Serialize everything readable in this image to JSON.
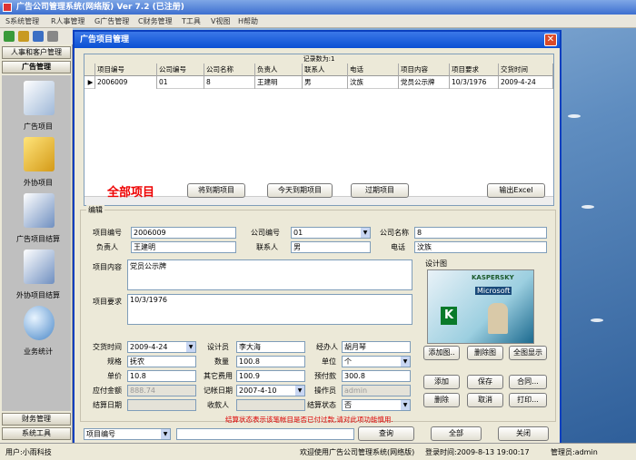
{
  "app": {
    "title": "广告公司管理系统(网络版) Ver 7.2 (已注册)"
  },
  "menu": [
    "S系统管理",
    "R人事管理",
    "G广告管理",
    "C财务管理",
    "T工具",
    "V视图",
    "H帮助"
  ],
  "sidebar": {
    "top_header": "人事和客户管理",
    "active_header": "广告管理",
    "items": [
      {
        "label": "广告项目"
      },
      {
        "label": "外协项目"
      },
      {
        "label": "广告项目结算"
      },
      {
        "label": "外协项目结算"
      },
      {
        "label": "业务统计"
      }
    ],
    "bottom_headers": [
      "财务管理",
      "系统工具"
    ]
  },
  "dialog": {
    "title": "广告项目管理",
    "record_count": "记录数为:1",
    "columns": [
      "项目编号",
      "公司编号",
      "公司名称",
      "负责人",
      "联系人",
      "电话",
      "项目内容",
      "项目要求",
      "交货时间"
    ],
    "rows": [
      [
        "2006009",
        "01",
        "8",
        "王建明",
        "男",
        "汶族",
        "党员公示牌",
        "10/3/1976",
        "2009-4-24"
      ]
    ],
    "filter_title": "全部项目",
    "buttons": {
      "due": "将到期项目",
      "today": "今天到期项目",
      "overdue": "过期项目",
      "excel": "输出Excel"
    },
    "edit_group": "编辑",
    "form": {
      "proj_no_label": "项目编号",
      "proj_no": "2006009",
      "company_no_label": "公司编号",
      "company_no": "01",
      "company_name_label": "公司名称",
      "company_name": "8",
      "owner_label": "负责人",
      "owner": "王建明",
      "contact_label": "联系人",
      "contact": "男",
      "phone_label": "电话",
      "phone": "汶族",
      "content_label": "项目内容",
      "content": "党员公示牌",
      "req_label": "项目要求",
      "req": "10/3/1976",
      "delivery_label": "交货时间",
      "delivery": "2009-4-24",
      "designer_label": "设计员",
      "designer": "李大海",
      "handler_label": "经办人",
      "handler": "胡月琴",
      "spec_label": "规格",
      "spec": "抚农",
      "qty_label": "数量",
      "qty": "100.8",
      "unit_label": "单位",
      "unit": "个",
      "price_label": "单价",
      "price": "10.8",
      "other_label": "其它费用",
      "other": "100.9",
      "prepay_label": "预付款",
      "prepay": "300.8",
      "receivable_label": "应付金额",
      "receivable": "888.74",
      "bookdate_label": "记帐日期",
      "bookdate": "2007-4-10",
      "operator_label": "操作员",
      "operator": "admin",
      "settle_date_label": "结算日期",
      "payee_label": "收款人",
      "settle_state_label": "结算状态",
      "settle_state": "否"
    },
    "design_label": "设计图",
    "design_img_text": {
      "brand": "KASPERSKY",
      "product": "Microsoft",
      "letter": "K"
    },
    "pic_buttons": {
      "add": "添加图..",
      "del": "删除图",
      "full": "全图显示"
    },
    "action_buttons": {
      "add": "添加",
      "save": "保存",
      "contract": "合同...",
      "delete": "删除",
      "cancel": "取消",
      "print": "打印..."
    },
    "note": "结算状态表示该笔帐目是否已付过款,请对此项功能慎用.",
    "search_field": "项目编号",
    "bottom_buttons": {
      "query": "查询",
      "all": "全部",
      "close": "关闭"
    }
  },
  "status": {
    "user": "用户:小雨科技",
    "welcome": "欢迎使用广告公司管理系统(网络版)",
    "login": "登录时间:2009-8-13 19:00:17",
    "admin": "管理员:admin"
  }
}
